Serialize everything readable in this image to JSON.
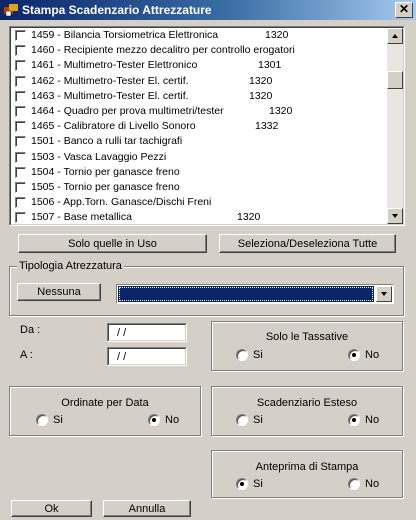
{
  "window": {
    "title": "Stampa Scadenzario Attrezzature",
    "close_glyph": "✕"
  },
  "list": {
    "items": [
      {
        "label": "1459 - Bilancia Torsiometrica Elettronica",
        "code": "1320"
      },
      {
        "label": "1460 - Recipiente mezzo decalitro per controllo erogatori",
        "code": ""
      },
      {
        "label": "1461 - Multimetro-Tester Elettronico",
        "code": "1301"
      },
      {
        "label": "1462 - Multimetro-Tester El. certif.",
        "code": "1320"
      },
      {
        "label": "1463 - Multimetro-Tester El. certif.",
        "code": "1320"
      },
      {
        "label": "1464 - Quadro per prova multimetri/tester",
        "code": "1320"
      },
      {
        "label": "1465 - Calibratore di Livello Sonoro",
        "code": "1332"
      },
      {
        "label": "1501 - Banco a rulli tar tachigrafi",
        "code": ""
      },
      {
        "label": "1503 - Vasca Lavaggio Pezzi",
        "code": ""
      },
      {
        "label": "1504 - Tornio per ganasce freno",
        "code": ""
      },
      {
        "label": "1505 - Tornio per ganasce freno",
        "code": ""
      },
      {
        "label": "1506 - App.Torn. Ganasce/Dischi Freni",
        "code": ""
      },
      {
        "label": "1507 - Base metallica",
        "code": "1320"
      }
    ]
  },
  "buttons": {
    "solo_in_uso": "Solo quelle in Uso",
    "seleziona_tutte": "Seleziona/Deseleziona Tutte",
    "nessuna": "Nessuna",
    "ok": "Ok",
    "annulla": "Annulla"
  },
  "tipologia": {
    "label": "Tipologia Atrezzatura",
    "selected": ""
  },
  "dates": {
    "da_label": "Da :",
    "a_label": "A :",
    "da_value": "/ /",
    "a_value": "/ /"
  },
  "options": {
    "solo_tassative": {
      "label": "Solo le Tassative",
      "si": "Si",
      "no": "No",
      "selected": "No"
    },
    "ordinate_data": {
      "label": "Ordinate per Data",
      "si": "Si",
      "no": "No",
      "selected": "No"
    },
    "scadenziario_esteso": {
      "label": "Scadenziario Esteso",
      "si": "Si",
      "no": "No",
      "selected": "No"
    },
    "anteprima": {
      "label": "Anteprima di Stampa",
      "si": "Si",
      "no": "No",
      "selected": "Si"
    }
  },
  "colors": {
    "titlebar": "#0a246a",
    "selection": "#0a246a",
    "face": "#d4d0c8"
  }
}
